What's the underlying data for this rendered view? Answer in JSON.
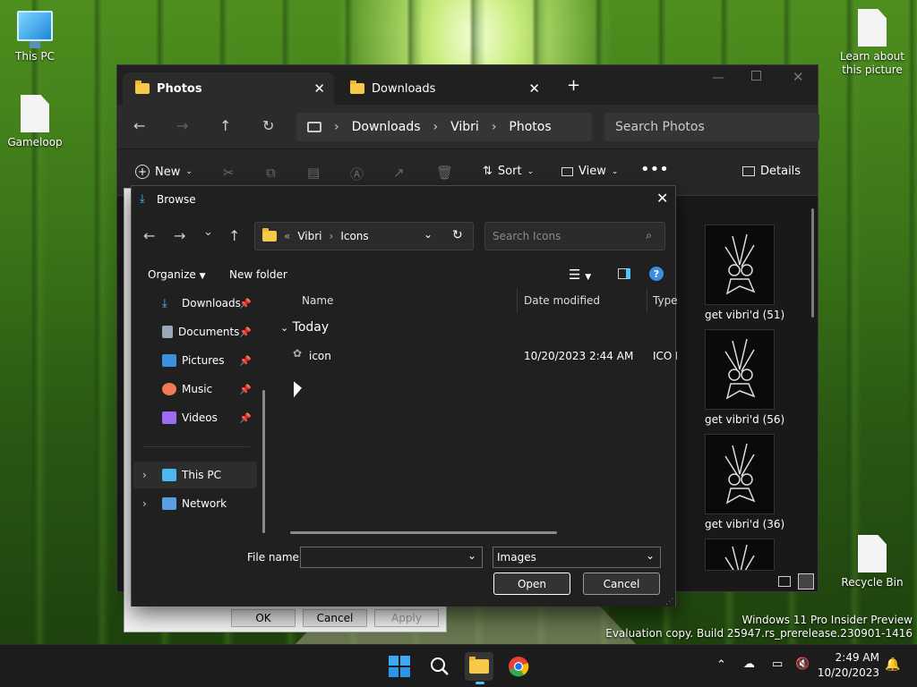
{
  "desktop": {
    "icons": [
      {
        "label": "This PC"
      },
      {
        "label": "Gameloop"
      },
      {
        "label": "Learn about this picture"
      },
      {
        "label": "Recycle Bin"
      }
    ],
    "watermark": {
      "line1": "Windows 11 Pro Insider Preview",
      "line2": "Evaluation copy. Build 25947.rs_prerelease.230901-1416"
    }
  },
  "explorer": {
    "tabs": [
      {
        "label": "Photos",
        "active": true
      },
      {
        "label": "Downloads",
        "active": false
      }
    ],
    "breadcrumb": [
      "Downloads",
      "Vibri",
      "Photos"
    ],
    "search_placeholder": "Search Photos",
    "commands": {
      "new": "New",
      "sort": "Sort",
      "view": "View",
      "details": "Details"
    },
    "thumbnails": [
      {
        "label": "get vibri'd (51)"
      },
      {
        "label": "get vibri'd (56)"
      },
      {
        "label": "get vibri'd (36)"
      }
    ]
  },
  "properties_dialog": {
    "ok": "OK",
    "cancel": "Cancel",
    "apply": "Apply"
  },
  "browse": {
    "title": "Browse",
    "address": {
      "overflow": "«",
      "parts": [
        "Vibri",
        "Icons"
      ]
    },
    "search_placeholder": "Search Icons",
    "organize": "Organize",
    "new_folder": "New folder",
    "nav_items": [
      {
        "label": "Downloads",
        "pinned": true,
        "color": "#4cc2ff"
      },
      {
        "label": "Documents",
        "pinned": true,
        "color": "#9aa7b8"
      },
      {
        "label": "Pictures",
        "pinned": true,
        "color": "#3d8fe0"
      },
      {
        "label": "Music",
        "pinned": true,
        "color": "#ef7b54"
      },
      {
        "label": "Videos",
        "pinned": true,
        "color": "#9b6cf2"
      },
      {
        "label": "This PC",
        "pinned": false,
        "color": "#4cb8ee"
      },
      {
        "label": "Network",
        "pinned": false,
        "color": "#5aa0e0"
      }
    ],
    "columns": {
      "name": "Name",
      "date": "Date modified",
      "type": "Type"
    },
    "group": "Today",
    "files": [
      {
        "name": "icon",
        "date": "10/20/2023 2:44 AM",
        "type": "ICO F"
      }
    ],
    "file_name_label": "File name:",
    "file_name_value": "",
    "filter": "Images",
    "open": "Open",
    "cancel": "Cancel"
  },
  "taskbar": {
    "time": "2:49 AM",
    "date": "10/20/2023"
  }
}
